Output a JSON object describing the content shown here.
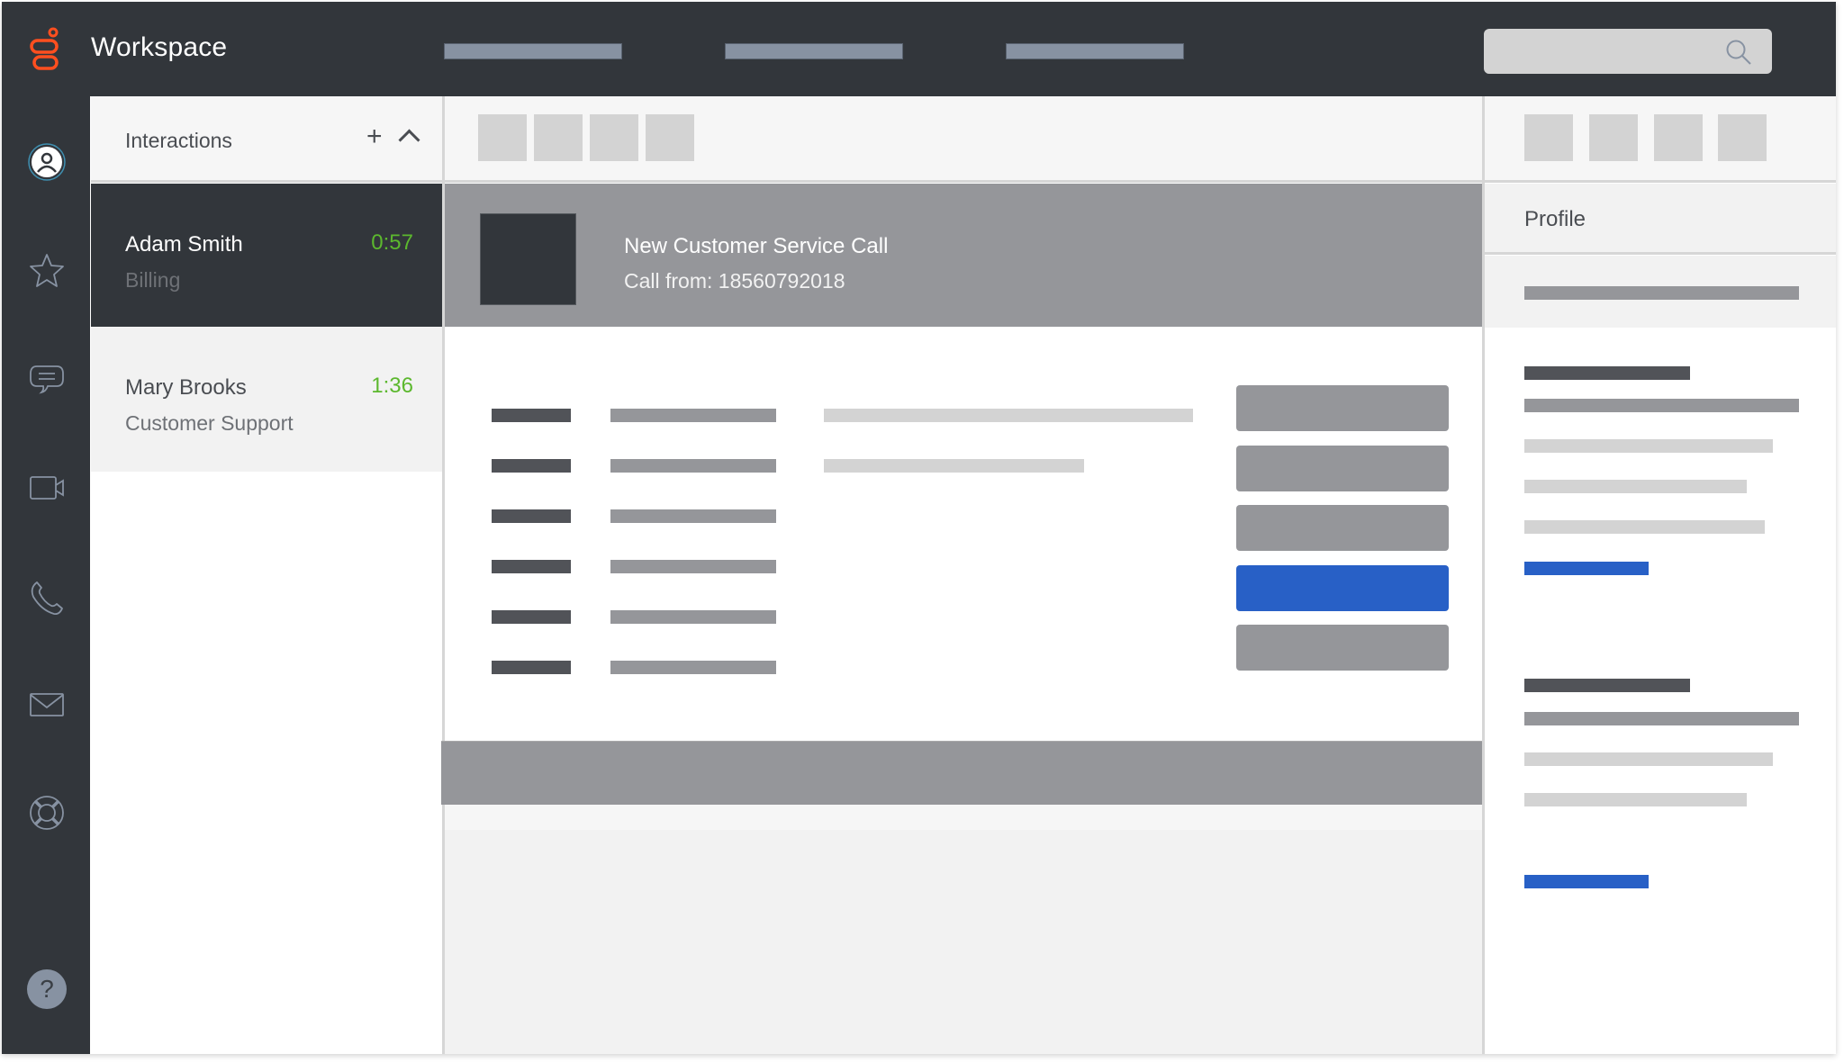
{
  "app": {
    "title": "Workspace",
    "brand_color": "#ff4f1f",
    "accent_color": "#2860c6",
    "timer_color": "#5cb82e"
  },
  "topnav": {
    "items": [
      {
        "label": ""
      },
      {
        "label": ""
      },
      {
        "label": ""
      }
    ],
    "search": {
      "placeholder": "",
      "value": "",
      "icon": "search-icon"
    }
  },
  "sidebar": {
    "items": [
      {
        "name": "user",
        "icon": "user-icon",
        "active": true
      },
      {
        "name": "favorites",
        "icon": "star-icon"
      },
      {
        "name": "chat",
        "icon": "chat-icon"
      },
      {
        "name": "video",
        "icon": "video-icon"
      },
      {
        "name": "phone",
        "icon": "phone-icon"
      },
      {
        "name": "email",
        "icon": "mail-icon"
      },
      {
        "name": "support",
        "icon": "lifebuoy-icon"
      }
    ],
    "help_label": "?"
  },
  "interactions": {
    "title": "Interactions",
    "add_label": "+",
    "items": [
      {
        "name": "Adam Smith",
        "queue": "Billing",
        "time": "0:57",
        "active": true
      },
      {
        "name": "Mary Brooks",
        "queue": "Customer Support",
        "time": "1:36",
        "active": false
      }
    ]
  },
  "call": {
    "title": "New Customer Service Call",
    "subtitle": "Call from: 18560792018"
  },
  "profile": {
    "title": "Profile"
  }
}
